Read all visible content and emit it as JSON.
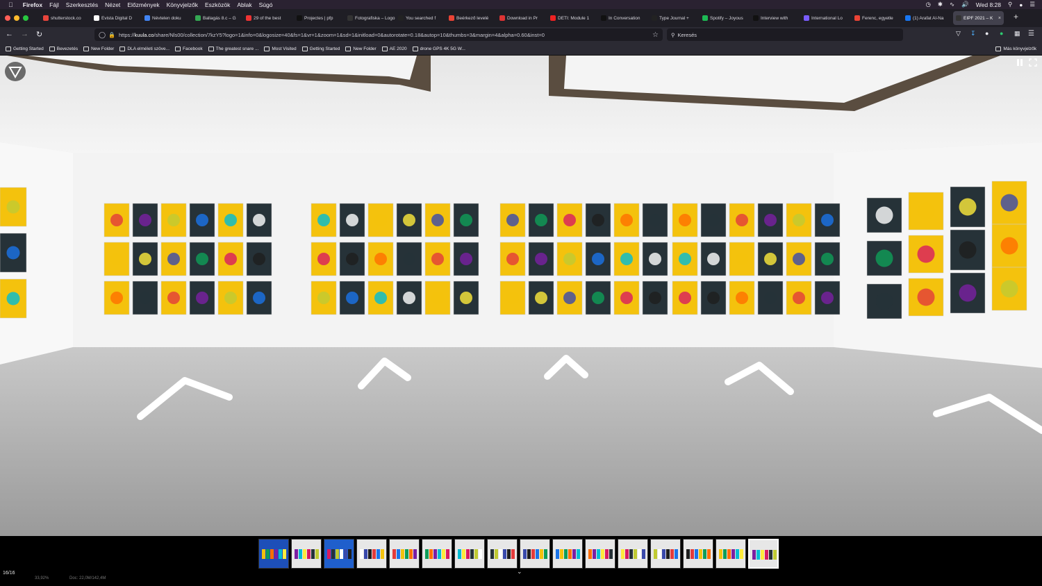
{
  "menubar": {
    "apple": "",
    "app": "Firefox",
    "items": [
      "Fájl",
      "Szerkesztés",
      "Nézet",
      "Előzmények",
      "Könyvjelzők",
      "Eszközök",
      "Ablak",
      "Súgó"
    ],
    "clock": "Wed 8:28"
  },
  "tabs": [
    {
      "label": "shutterstock.co",
      "color": "#e8453c"
    },
    {
      "label": "Evista Digital D",
      "color": "#ffffff"
    },
    {
      "label": "Névtelen doku",
      "color": "#4285f4"
    },
    {
      "label": "Ballagás 8.c – G",
      "color": "#34a853"
    },
    {
      "label": "29 of the best",
      "color": "#e33"
    },
    {
      "label": "Projectes | pfp",
      "color": "#111"
    },
    {
      "label": "Fotografiska – Logo",
      "color": "#333"
    },
    {
      "label": "You searched f",
      "color": "#222"
    },
    {
      "label": "Beérkező levelé",
      "color": "#ea4335"
    },
    {
      "label": "Download in Pr",
      "color": "#d33"
    },
    {
      "label": "DETI: Module 1",
      "color": "#e22"
    },
    {
      "label": "In Conversation",
      "color": "#111"
    },
    {
      "label": "Type Journal +",
      "color": "#222"
    },
    {
      "label": "Spotify – Joyous",
      "color": "#1db954"
    },
    {
      "label": "Interview with",
      "color": "#111"
    },
    {
      "label": "International Lo",
      "color": "#7a5cff"
    },
    {
      "label": "Ferenc, egyetle",
      "color": "#ea4335"
    },
    {
      "label": "(1) Arafat Al-Na",
      "color": "#1877f2"
    },
    {
      "label": "EIPF 2021 – K",
      "color": "#333",
      "active": true
    }
  ],
  "nav": {
    "url_prefix": "https://",
    "url_host": "kuula.co",
    "url_path": "/share/Nls00/collection/7kzY5?logo=1&info=0&logosize=40&fs=1&vr=1&zoom=1&sd=1&initload=0&autorotate=0.18&autop=10&thumbs=3&margin=4&alpha=0.60&inst=0",
    "search_placeholder": "Keresés"
  },
  "bookmarks": [
    "Getting Started",
    "Bevezetés",
    "New Folder",
    "DLA elméleti szöve...",
    "Facebook",
    "The greatest snare ...",
    "Most Visited",
    "Getting Started",
    "New Folder",
    "AE 2020",
    "drone GPS 4K 5G W..."
  ],
  "bookmarks_other": "Más könyvjelzők",
  "viewer": {
    "counter": "16/16",
    "status_left": "33,92%",
    "status_doc": "Doc: 22,0M/142,4M",
    "thumb_count": 16,
    "active_thumb": 16
  },
  "icons": {
    "back": "back-arrow-icon",
    "forward": "forward-arrow-icon",
    "reload": "reload-icon",
    "shield": "tracking-shield-icon",
    "lock": "lock-icon",
    "star": "bookmark-star-icon",
    "search": "search-icon",
    "pause": "pause-icon",
    "fullscreen": "fullscreen-icon",
    "chevron": "chevron-down-icon"
  }
}
